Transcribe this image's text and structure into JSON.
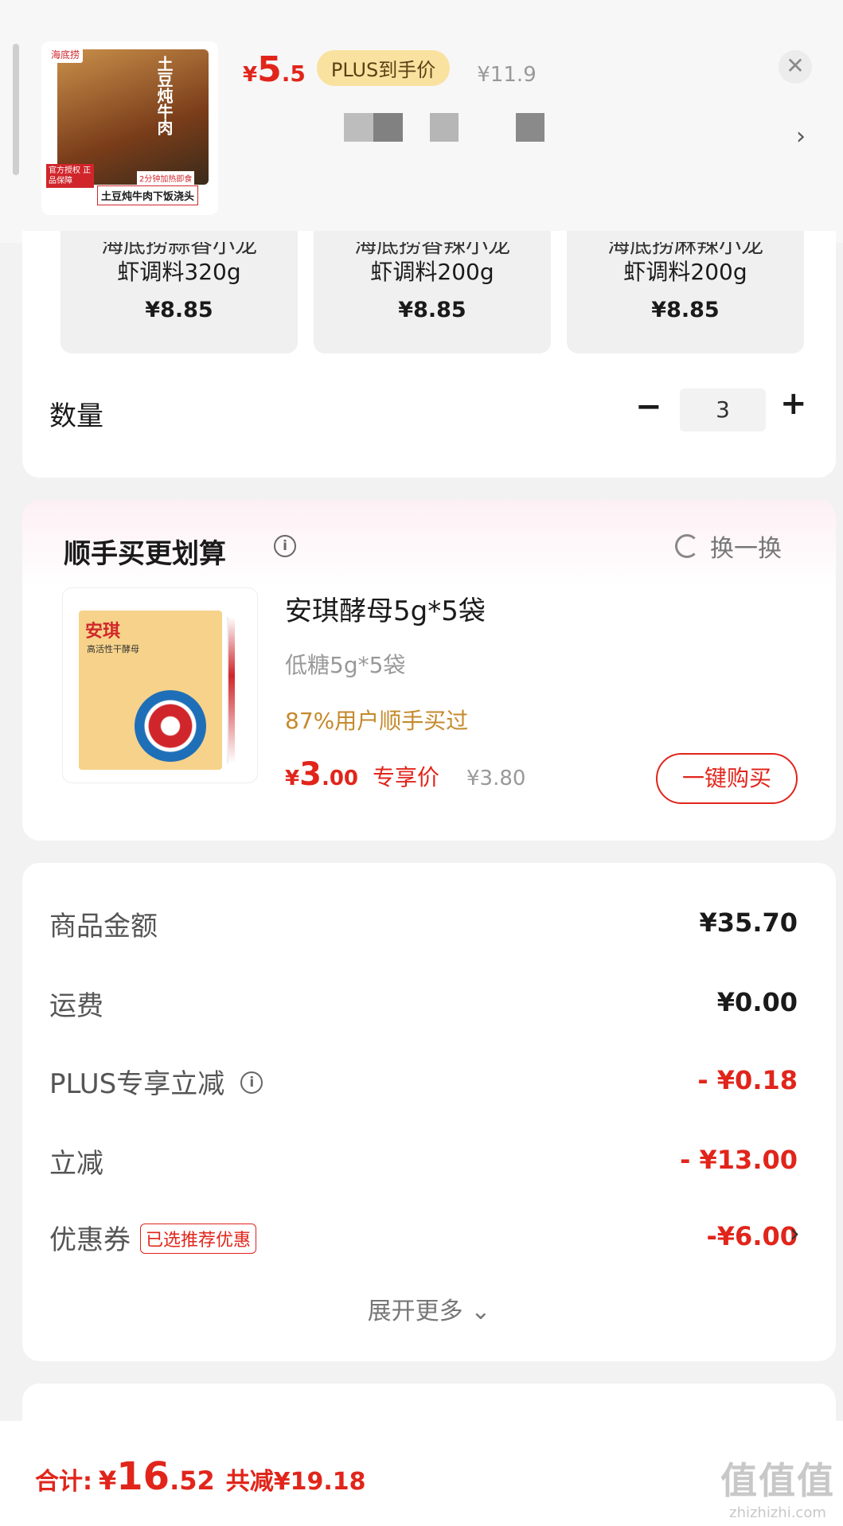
{
  "header": {
    "thumb_brand": "海底捞",
    "thumb_dish": "土豆炖牛肉",
    "thumb_tag_auth": "官方授权 正品保障",
    "thumb_tag_heat": "2分钟加热即食",
    "thumb_tag_name": "土豆炖牛肉下饭浇头",
    "price_currency": "¥",
    "price_int": "5",
    "price_dec": ".5",
    "plus_label": "PLUS到手价",
    "price_original": "¥11.9",
    "close_symbol": "✕",
    "next_symbol": "›"
  },
  "variants": [
    {
      "name_top": "海底捞蒜香小龙",
      "name_bottom": "虾调料320g",
      "price": "¥8.85"
    },
    {
      "name_top": "海底捞香辣小龙",
      "name_bottom": "虾调料200g",
      "price": "¥8.85"
    },
    {
      "name_top": "海底捞麻辣小龙",
      "name_bottom": "虾调料200g",
      "price": "¥8.85"
    }
  ],
  "quantity": {
    "label": "数量",
    "minus": "−",
    "value": "3",
    "plus": "+"
  },
  "recommend": {
    "title": "顺手买更划算",
    "info_symbol": "i",
    "refresh_label": "换一换",
    "product_pack_title": "安琪",
    "product_pack_sub": "高活性干酵母",
    "product_name": "安琪酵母5g*5袋",
    "product_sub": "低糖5g*5袋",
    "product_stat": "87%用户顺手买过",
    "price_currency": "¥",
    "price_int": "3",
    "price_dec": ".00",
    "price_label": "专享价",
    "price_original": "¥3.80",
    "buy_label": "一键购买"
  },
  "summary": {
    "rows": [
      {
        "label": "商品金额",
        "value": "¥35.70"
      },
      {
        "label": "运费",
        "value": "¥0.00"
      },
      {
        "label": "PLUS专享立减",
        "value": "- ¥0.18"
      },
      {
        "label": "立减",
        "value": "- ¥13.00"
      },
      {
        "label": "优惠券",
        "value": "-¥6.00"
      }
    ],
    "coupon_tag": "已选推荐优惠",
    "expand_label": "展开更多",
    "expand_chevron": "⌄",
    "info_symbol": "i",
    "coupon_chevron": "›"
  },
  "bottom": {
    "total_label": "合计:",
    "total_currency": "¥",
    "total_int": "16",
    "total_dec": ".52",
    "savings": "共减¥19.18"
  },
  "watermark": {
    "brand": "值值值",
    "url": "zhizhizhi.com"
  },
  "colors": {
    "accent": "#e1251b",
    "plus_badge": "#f9e2a0",
    "stat": "#c48a2c"
  }
}
